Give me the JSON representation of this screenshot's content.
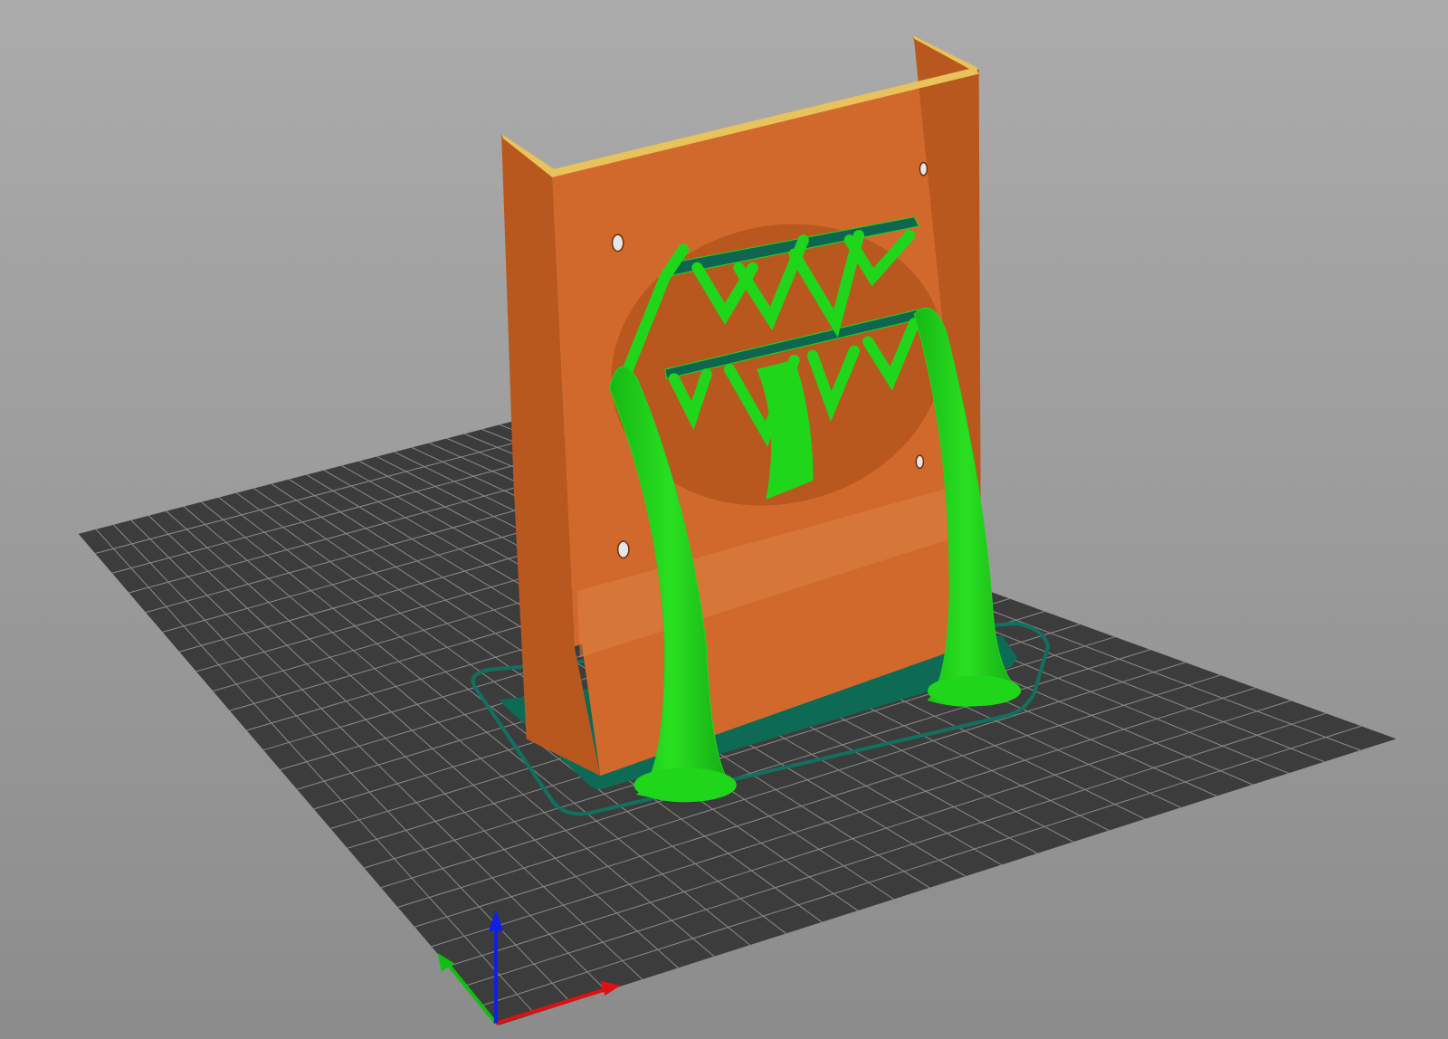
{
  "viewport": {
    "view": "3d-preview",
    "colors": {
      "background_top": "#ababab",
      "background_bottom": "#8c8c8c",
      "bed": "#3c3c3c",
      "grid": "#8a8a8a",
      "model": "#d2692c",
      "model_shade": "#b8581f",
      "model_top": "#e8c25a",
      "support": "#1fd61a",
      "support_shade": "#0ea80c",
      "brim": "#0d6b55",
      "axis_x": "#e01010",
      "axis_y": "#10c010",
      "axis_z": "#1020e0"
    },
    "grid_divisions": 25
  }
}
